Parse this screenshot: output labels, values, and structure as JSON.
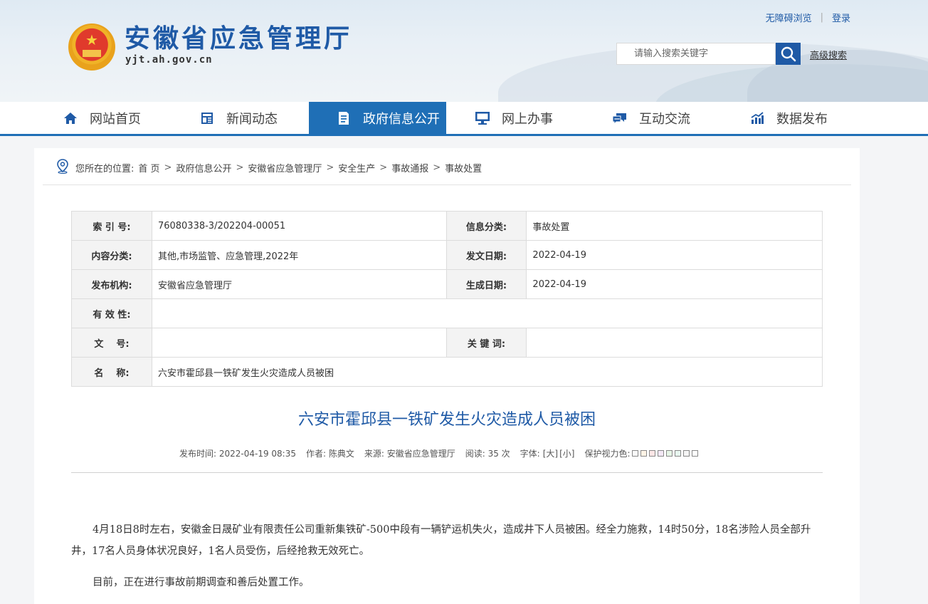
{
  "header": {
    "site_title": "安徽省应急管理厅",
    "domain": "yjt.ah.gov.cn",
    "accessibility_link": "无障碍浏览",
    "separator": "|",
    "login_link": "登录",
    "search_placeholder": "请输入搜索关键字",
    "advanced_search": "高级搜索"
  },
  "nav": {
    "items": [
      {
        "label": "网站首页",
        "icon": "home-icon"
      },
      {
        "label": "新闻动态",
        "icon": "news-icon"
      },
      {
        "label": "政府信息公开",
        "icon": "document-icon",
        "active": true
      },
      {
        "label": "网上办事",
        "icon": "monitor-icon"
      },
      {
        "label": "互动交流",
        "icon": "chat-icon"
      },
      {
        "label": "数据发布",
        "icon": "chart-icon"
      }
    ]
  },
  "breadcrumb": {
    "prefix": "您所在的位置:",
    "items": [
      "首 页",
      "政府信息公开",
      "安徽省应急管理厅",
      "安全生产",
      "事故通报",
      "事故处置"
    ],
    "arrow": ">"
  },
  "meta": {
    "index_label": "索 引 号:",
    "index_value": "76080338-3/202204-00051",
    "category_label": "信息分类:",
    "category_value": "事故处置",
    "content_type_label": "内容分类:",
    "content_type_value": "其他,市场监管、应急管理,2022年",
    "issue_date_label": "发文日期:",
    "issue_date_value": "2022-04-19",
    "publisher_label": "发布机构:",
    "publisher_value": "安徽省应急管理厅",
    "created_date_label": "生成日期:",
    "created_date_value": "2022-04-19",
    "validity_label": "有 效 性:",
    "validity_value": "",
    "doc_number_label": "文    号:",
    "doc_number_value": "",
    "keywords_label": "关 键 词:",
    "keywords_value": "",
    "name_label": "名    称:",
    "name_value": "六安市霍邱县一铁矿发生火灾造成人员被困"
  },
  "article": {
    "title": "六安市霍邱县一铁矿发生火灾造成人员被困",
    "publish_time": "发布时间: 2022-04-19 08:35",
    "author": "作者: 陈典文",
    "source": "来源: 安徽省应急管理厅",
    "views": "阅读: 35 次",
    "font_size_label": "字体:",
    "font_large": "[大]",
    "font_small": "[小]",
    "eye_care_label": "保护视力色:",
    "eye_care_colors": [
      "#fafafa",
      "#fff4e6",
      "#fde6e6",
      "#f3e8f5",
      "#e6f5e6",
      "#e8f7f0",
      "#f5f5f5",
      "#ffffff"
    ],
    "paragraphs": [
      "4月18日8时左右，安徽金日晟矿业有限责任公司重新集铁矿-500中段有一辆铲运机失火，造成井下人员被困。经全力施救，14时50分，18名涉险人员全部升井，17名人员身体状况良好，1名人员受伤，后经抢救无效死亡。",
      "目前，正在进行事故前期调查和善后处置工作。"
    ]
  },
  "colors": {
    "brand_blue": "#1f5aa6",
    "nav_active": "#1f6fb6"
  }
}
